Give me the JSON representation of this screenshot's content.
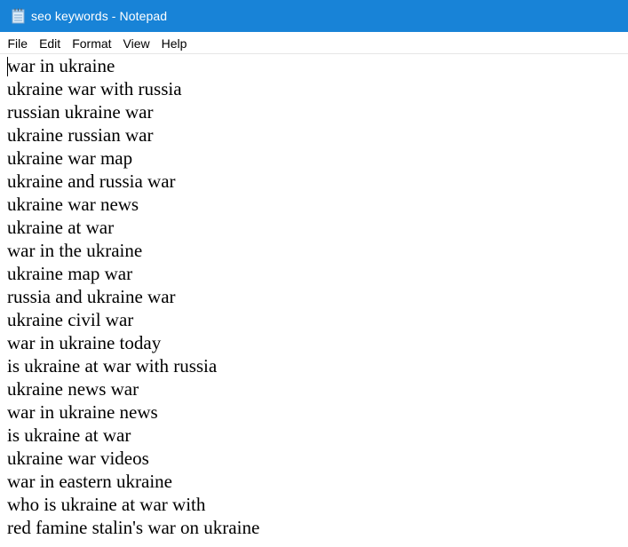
{
  "window": {
    "title": "seo keywords - Notepad",
    "accent_color": "#1883d7",
    "app_icon": "notepad-icon"
  },
  "menu": {
    "items": [
      {
        "label": "File"
      },
      {
        "label": "Edit"
      },
      {
        "label": "Format"
      },
      {
        "label": "View"
      },
      {
        "label": "Help"
      }
    ]
  },
  "document": {
    "lines": [
      "war in ukraine",
      "ukraine war with russia",
      "russian ukraine war",
      "ukraine russian war",
      "ukraine war map",
      "ukraine and russia war",
      "ukraine war news",
      "ukraine at war",
      "war in the ukraine",
      "ukraine map war",
      "russia and ukraine war",
      "ukraine civil war",
      "war in ukraine today",
      "is ukraine at war with russia",
      "ukraine news war",
      "war in ukraine news",
      "is ukraine at war",
      "ukraine war videos",
      "war in eastern ukraine",
      "who is ukraine at war with",
      "red famine stalin's war on ukraine"
    ]
  }
}
